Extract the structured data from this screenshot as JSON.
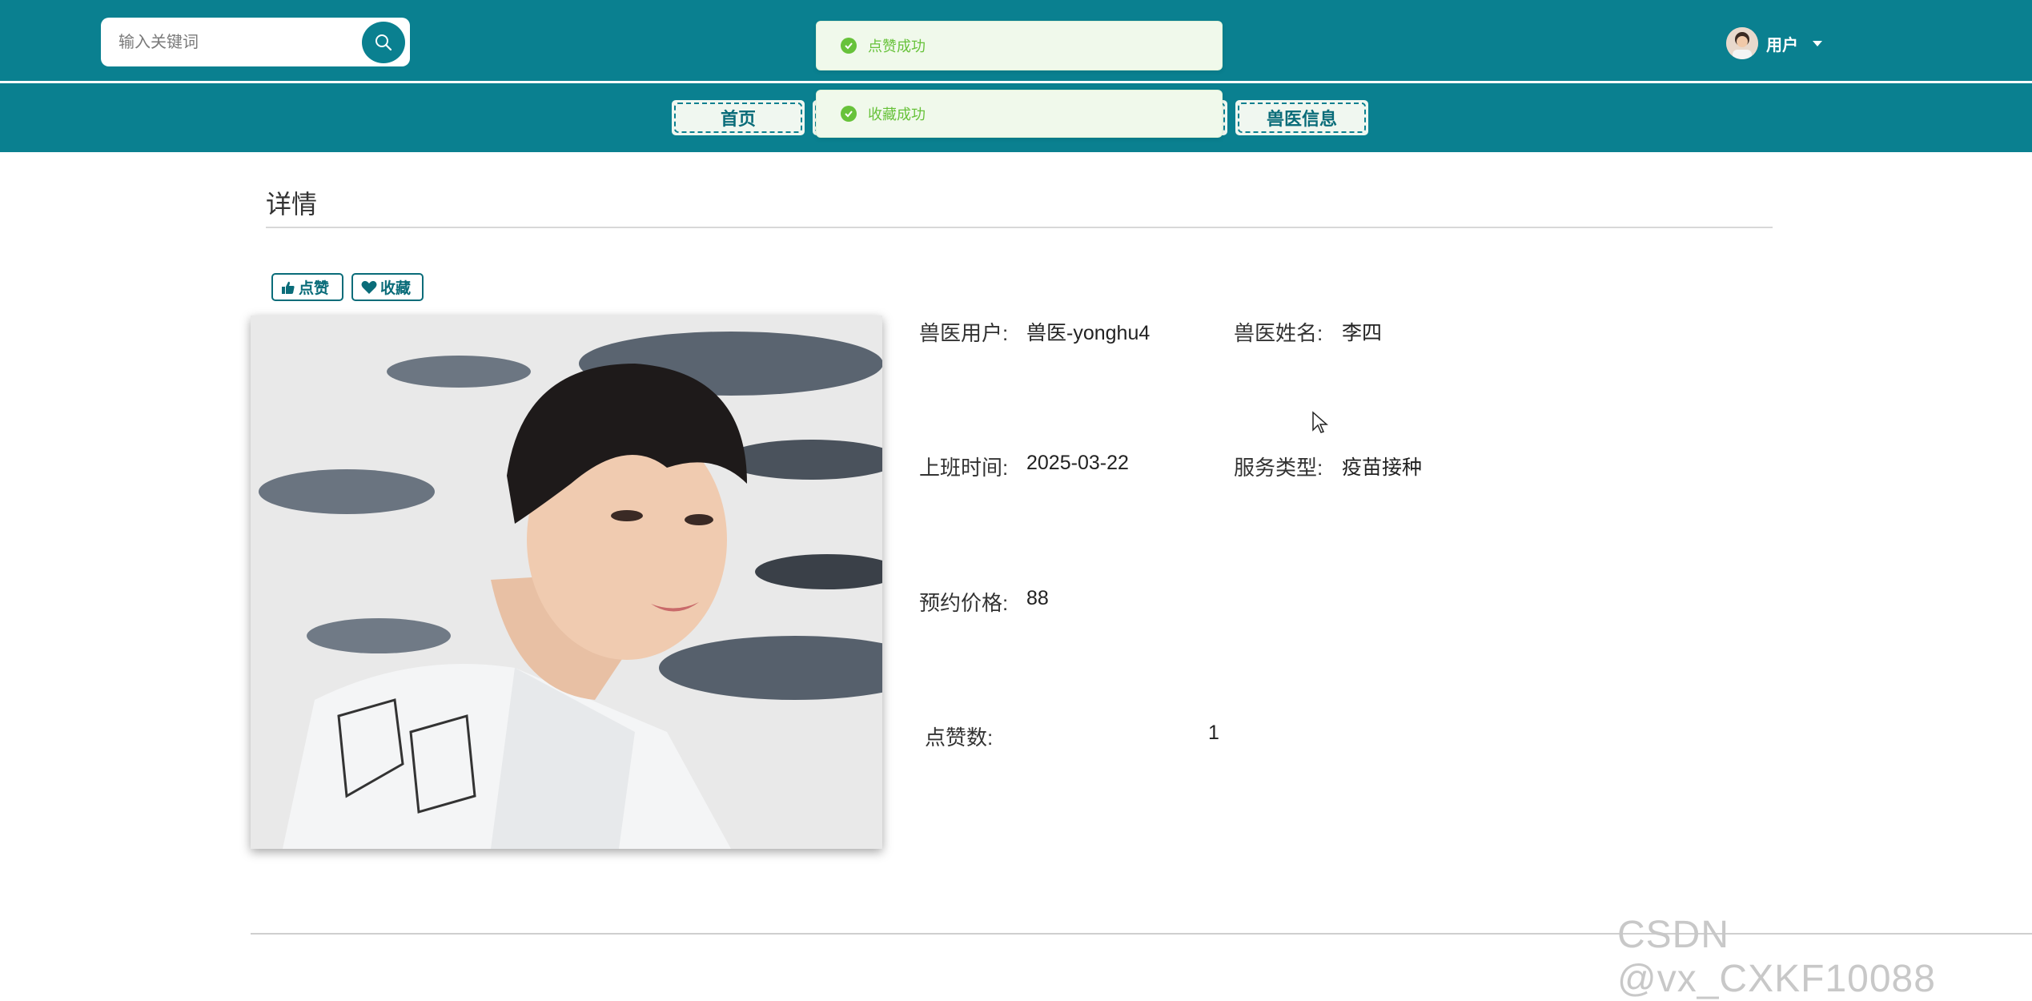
{
  "header": {
    "search_placeholder": "输入关键词",
    "user_name": "用户"
  },
  "nav": {
    "home": "首页",
    "vet_info": "兽医信息"
  },
  "toasts": [
    {
      "text": "点赞成功"
    },
    {
      "text": "收藏成功"
    }
  ],
  "page": {
    "title": "详情",
    "like_button": "点赞",
    "favorite_button": "收藏"
  },
  "details": {
    "vet_user_label": "兽医用户:",
    "vet_user_value": "兽医-yonghu4",
    "vet_name_label": "兽医姓名:",
    "vet_name_value": "李四",
    "work_time_label": "上班时间:",
    "work_time_value": "2025-03-22",
    "service_type_label": "服务类型:",
    "service_type_value": "疫苗接种",
    "price_label": "预约价格:",
    "price_value": "88",
    "likes_label": "点赞数:",
    "likes_value": "1"
  },
  "watermark": "CSDN @vx_CXKF10088",
  "colors": {
    "primary": "#0a8090",
    "success": "#67c23a",
    "success_bg": "#f0f9eb"
  }
}
